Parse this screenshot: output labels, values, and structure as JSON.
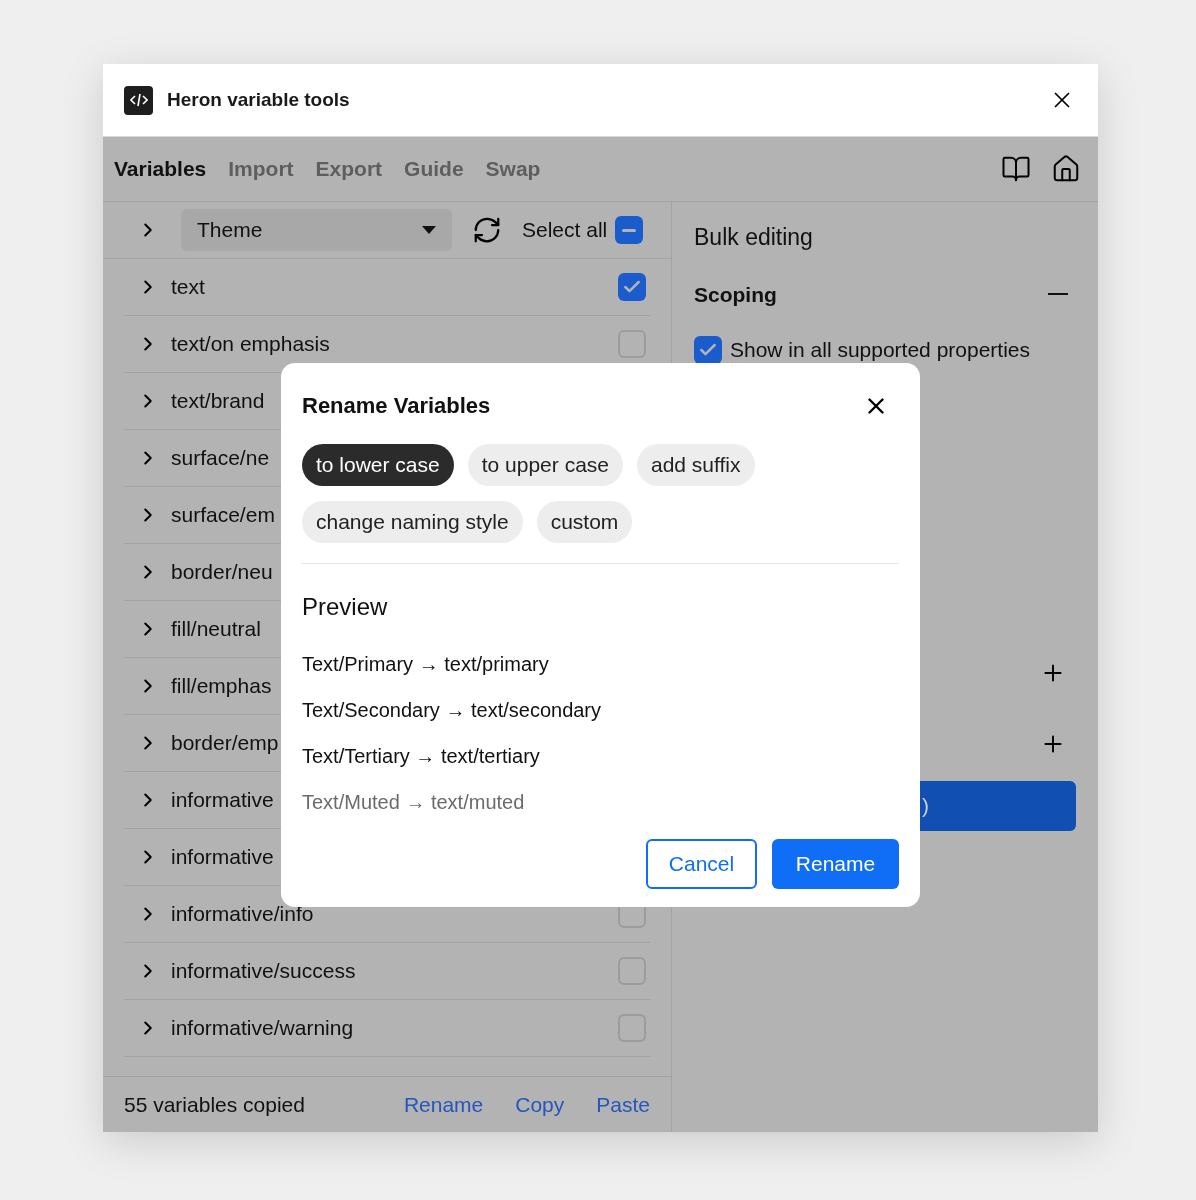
{
  "window": {
    "title": "Heron variable tools"
  },
  "tabs": [
    {
      "label": "Variables",
      "selected": true
    },
    {
      "label": "Import",
      "selected": false
    },
    {
      "label": "Export",
      "selected": false
    },
    {
      "label": "Guide",
      "selected": false
    },
    {
      "label": "Swap",
      "selected": false
    }
  ],
  "toolbar": {
    "collection": "Theme",
    "select_all": {
      "label": "Select all",
      "indeterminate": true
    }
  },
  "variables": [
    {
      "name": "text",
      "checked": true
    },
    {
      "name": "text/on emphasis",
      "checked": false
    },
    {
      "name": "text/brand"
    },
    {
      "name": "surface/ne"
    },
    {
      "name": "surface/em"
    },
    {
      "name": "border/neu"
    },
    {
      "name": "fill/neutral"
    },
    {
      "name": "fill/emphas"
    },
    {
      "name": "border/emp"
    },
    {
      "name": "informative"
    },
    {
      "name": "informative"
    },
    {
      "name": "informative/info",
      "checked": false
    },
    {
      "name": "informative/success",
      "checked": false
    },
    {
      "name": "informative/warning",
      "checked": false
    }
  ],
  "footer": {
    "status": "55 variables copied",
    "links": [
      "Rename",
      "Copy",
      "Paste"
    ]
  },
  "bulk_editing": {
    "title": "Bulk editing",
    "scoping": {
      "title": "Scoping",
      "expanded": true,
      "option": {
        "label": "Show in all supported properties",
        "checked": true
      }
    },
    "apply_button": ")"
  },
  "dialog": {
    "title": "Rename Variables",
    "options": [
      {
        "label": "to lower case",
        "selected": true
      },
      {
        "label": "to upper case",
        "selected": false
      },
      {
        "label": "add suffix",
        "selected": false
      },
      {
        "label": "change naming style",
        "selected": false
      },
      {
        "label": "custom",
        "selected": false
      }
    ],
    "preview_title": "Preview",
    "preview": [
      {
        "text": "Text/Primary → text/primary",
        "muted": false
      },
      {
        "text": "Text/Secondary → text/secondary",
        "muted": false
      },
      {
        "text": "Text/Tertiary → text/tertiary",
        "muted": false
      },
      {
        "text": "Text/Muted → text/muted",
        "muted": true
      }
    ],
    "buttons": [
      {
        "label": "Cancel",
        "kind": "secondary"
      },
      {
        "label": "Rename",
        "kind": "primary"
      }
    ]
  }
}
